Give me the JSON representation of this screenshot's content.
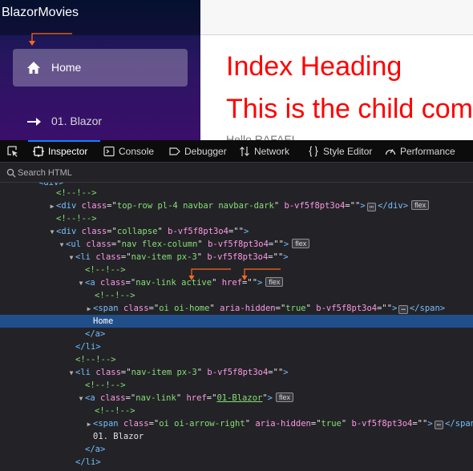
{
  "app": {
    "brand": "BlazorMovies",
    "nav": [
      {
        "label": "Home",
        "icon": "home-icon",
        "active": true
      },
      {
        "label": "01. Blazor",
        "icon": "arrow-right-icon",
        "active": false
      }
    ],
    "index_heading": "Index Heading",
    "child_heading": "This is the child component",
    "hello_text": "Hello RAFAEL"
  },
  "devtools": {
    "tabs": [
      {
        "label": "Inspector",
        "icon": "inspector-icon",
        "selected": true
      },
      {
        "label": "Console",
        "icon": "console-icon",
        "selected": false
      },
      {
        "label": "Debugger",
        "icon": "debugger-icon",
        "selected": false
      },
      {
        "label": "Network",
        "icon": "network-icon",
        "selected": false
      },
      {
        "label": "Style Editor",
        "icon": "style-editor-icon",
        "selected": false
      },
      {
        "label": "Performance",
        "icon": "performance-icon",
        "selected": false
      }
    ],
    "search_placeholder": "Search HTML",
    "badges": {
      "flex": "flex",
      "ellipsis": "…"
    },
    "comment": "<!--!-->",
    "markup": {
      "div_top_row": {
        "tag": "div",
        "class_attr": "class",
        "class_val": "top-row pl-4 navbar navbar-dark",
        "scope_attr": "b-vf5f8pt3o4",
        "scope_val": ""
      },
      "div_collapse": {
        "tag": "div",
        "class_attr": "class",
        "class_val": "collapse",
        "scope_attr": "b-vf5f8pt3o4",
        "scope_val": ""
      },
      "ul_nav": {
        "tag": "ul",
        "class_attr": "class",
        "class_val": "nav flex-column",
        "scope_attr": "b-vf5f8pt3o4",
        "scope_val": ""
      },
      "li_1": {
        "tag": "li",
        "class_attr": "class",
        "class_val": "nav-item px-3",
        "scope_attr": "b-vf5f8pt3o4",
        "scope_val": ""
      },
      "a_1": {
        "tag": "a",
        "class_attr": "class",
        "class_val": "nav-link active",
        "href_attr": "href",
        "href_val": ""
      },
      "span_1": {
        "tag": "span",
        "class_attr": "class",
        "class_val": "oi oi-home",
        "aria_attr": "aria-hidden",
        "aria_val": "true",
        "scope_attr": "b-vf5f8pt3o4",
        "scope_val": ""
      },
      "text_1": "Home",
      "li_2": {
        "tag": "li",
        "class_attr": "class",
        "class_val": "nav-item px-3",
        "scope_attr": "b-vf5f8pt3o4",
        "scope_val": ""
      },
      "a_2": {
        "tag": "a",
        "class_attr": "class",
        "class_val": "nav-link",
        "href_attr": "href",
        "href_val": "01-Blazor"
      },
      "span_2": {
        "tag": "span",
        "class_attr": "class",
        "class_val": "oi oi-arrow-right",
        "aria_attr": "aria-hidden",
        "aria_val": "true",
        "scope_attr": "b-vf5f8pt3o4",
        "scope_val": ""
      },
      "text_2": "01. Blazor"
    }
  },
  "colors": {
    "heading_red": "#ff0000",
    "selection_blue": "#204e8a",
    "annotation_orange": "#ff6a1a",
    "devtools_bg": "#232327"
  }
}
